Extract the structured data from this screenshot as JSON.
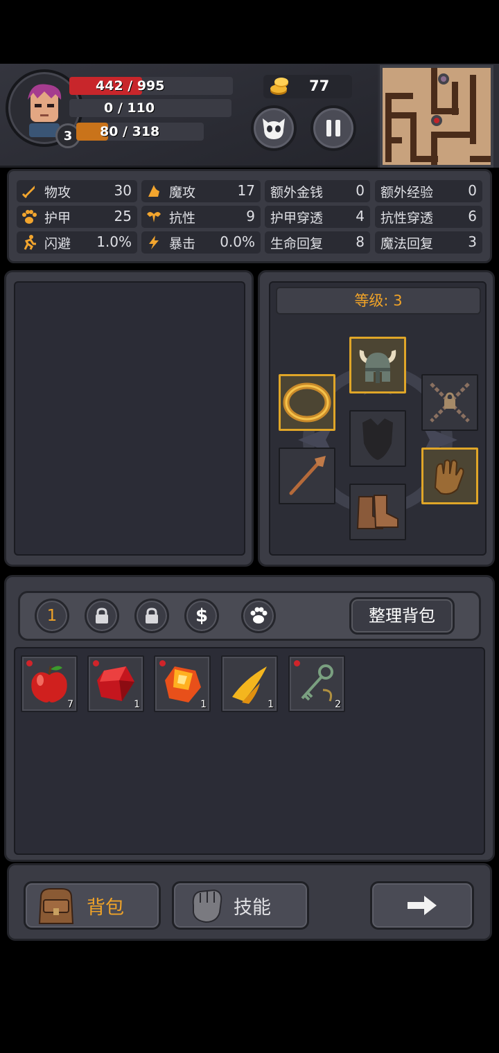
{
  "hud": {
    "hp_text": "442 / 995",
    "hp_fraction": 0.444,
    "mp_text": "0 / 110",
    "xp_text": "80 / 318",
    "xp_fraction": 0.25,
    "player_level": "3",
    "gold": "77"
  },
  "stats": [
    {
      "label": "物攻",
      "value": "30",
      "icon": "sword-icon"
    },
    {
      "label": "魔攻",
      "value": "17",
      "icon": "wizard-hat-icon"
    },
    {
      "label": "额外金钱",
      "value": "0"
    },
    {
      "label": "额外经验",
      "value": "0"
    },
    {
      "label": "护甲",
      "value": "25",
      "icon": "paw-icon"
    },
    {
      "label": "抗性",
      "value": "9",
      "icon": "muscle-icon"
    },
    {
      "label": "护甲穿透",
      "value": "4"
    },
    {
      "label": "抗性穿透",
      "value": "6"
    },
    {
      "label": "闪避",
      "value": "1.0%",
      "icon": "running-icon"
    },
    {
      "label": "暴击",
      "value": "0.0%",
      "icon": "lightning-icon"
    },
    {
      "label": "生命回复",
      "value": "8"
    },
    {
      "label": "魔法回复",
      "value": "3"
    }
  ],
  "equipment": {
    "level_label": "等级: 3"
  },
  "bag": {
    "tab_page": "1",
    "sort_label": "整理背包",
    "items": [
      {
        "name": "apple",
        "qty": "7"
      },
      {
        "name": "red-gem",
        "qty": "1"
      },
      {
        "name": "orange-gem",
        "qty": "1"
      },
      {
        "name": "golden-fang",
        "qty": "1"
      },
      {
        "name": "key",
        "qty": "2"
      }
    ]
  },
  "nav": {
    "bag_label": "背包",
    "skill_label": "技能"
  },
  "colors": {
    "hp": "#c8262b",
    "xp": "#c9731a",
    "accent": "#f0a328",
    "slot_highlight": "#e0a628"
  }
}
